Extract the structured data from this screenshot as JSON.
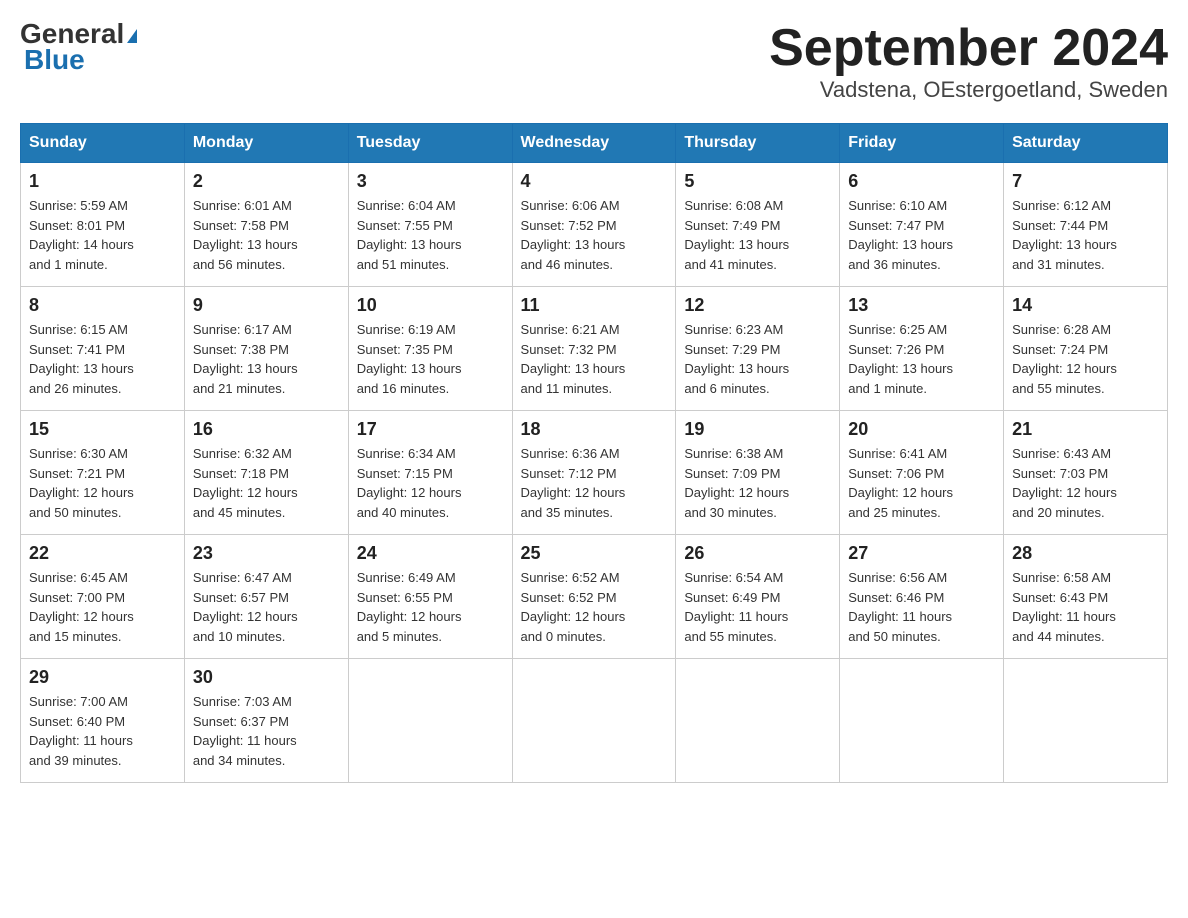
{
  "header": {
    "logo_general": "General",
    "logo_blue": "Blue",
    "month_title": "September 2024",
    "location": "Vadstena, OEstergoetland, Sweden"
  },
  "weekdays": [
    "Sunday",
    "Monday",
    "Tuesday",
    "Wednesday",
    "Thursday",
    "Friday",
    "Saturday"
  ],
  "weeks": [
    [
      {
        "day": "1",
        "sunrise": "5:59 AM",
        "sunset": "8:01 PM",
        "daylight": "14 hours and 1 minute."
      },
      {
        "day": "2",
        "sunrise": "6:01 AM",
        "sunset": "7:58 PM",
        "daylight": "13 hours and 56 minutes."
      },
      {
        "day": "3",
        "sunrise": "6:04 AM",
        "sunset": "7:55 PM",
        "daylight": "13 hours and 51 minutes."
      },
      {
        "day": "4",
        "sunrise": "6:06 AM",
        "sunset": "7:52 PM",
        "daylight": "13 hours and 46 minutes."
      },
      {
        "day": "5",
        "sunrise": "6:08 AM",
        "sunset": "7:49 PM",
        "daylight": "13 hours and 41 minutes."
      },
      {
        "day": "6",
        "sunrise": "6:10 AM",
        "sunset": "7:47 PM",
        "daylight": "13 hours and 36 minutes."
      },
      {
        "day": "7",
        "sunrise": "6:12 AM",
        "sunset": "7:44 PM",
        "daylight": "13 hours and 31 minutes."
      }
    ],
    [
      {
        "day": "8",
        "sunrise": "6:15 AM",
        "sunset": "7:41 PM",
        "daylight": "13 hours and 26 minutes."
      },
      {
        "day": "9",
        "sunrise": "6:17 AM",
        "sunset": "7:38 PM",
        "daylight": "13 hours and 21 minutes."
      },
      {
        "day": "10",
        "sunrise": "6:19 AM",
        "sunset": "7:35 PM",
        "daylight": "13 hours and 16 minutes."
      },
      {
        "day": "11",
        "sunrise": "6:21 AM",
        "sunset": "7:32 PM",
        "daylight": "13 hours and 11 minutes."
      },
      {
        "day": "12",
        "sunrise": "6:23 AM",
        "sunset": "7:29 PM",
        "daylight": "13 hours and 6 minutes."
      },
      {
        "day": "13",
        "sunrise": "6:25 AM",
        "sunset": "7:26 PM",
        "daylight": "13 hours and 1 minute."
      },
      {
        "day": "14",
        "sunrise": "6:28 AM",
        "sunset": "7:24 PM",
        "daylight": "12 hours and 55 minutes."
      }
    ],
    [
      {
        "day": "15",
        "sunrise": "6:30 AM",
        "sunset": "7:21 PM",
        "daylight": "12 hours and 50 minutes."
      },
      {
        "day": "16",
        "sunrise": "6:32 AM",
        "sunset": "7:18 PM",
        "daylight": "12 hours and 45 minutes."
      },
      {
        "day": "17",
        "sunrise": "6:34 AM",
        "sunset": "7:15 PM",
        "daylight": "12 hours and 40 minutes."
      },
      {
        "day": "18",
        "sunrise": "6:36 AM",
        "sunset": "7:12 PM",
        "daylight": "12 hours and 35 minutes."
      },
      {
        "day": "19",
        "sunrise": "6:38 AM",
        "sunset": "7:09 PM",
        "daylight": "12 hours and 30 minutes."
      },
      {
        "day": "20",
        "sunrise": "6:41 AM",
        "sunset": "7:06 PM",
        "daylight": "12 hours and 25 minutes."
      },
      {
        "day": "21",
        "sunrise": "6:43 AM",
        "sunset": "7:03 PM",
        "daylight": "12 hours and 20 minutes."
      }
    ],
    [
      {
        "day": "22",
        "sunrise": "6:45 AM",
        "sunset": "7:00 PM",
        "daylight": "12 hours and 15 minutes."
      },
      {
        "day": "23",
        "sunrise": "6:47 AM",
        "sunset": "6:57 PM",
        "daylight": "12 hours and 10 minutes."
      },
      {
        "day": "24",
        "sunrise": "6:49 AM",
        "sunset": "6:55 PM",
        "daylight": "12 hours and 5 minutes."
      },
      {
        "day": "25",
        "sunrise": "6:52 AM",
        "sunset": "6:52 PM",
        "daylight": "12 hours and 0 minutes."
      },
      {
        "day": "26",
        "sunrise": "6:54 AM",
        "sunset": "6:49 PM",
        "daylight": "11 hours and 55 minutes."
      },
      {
        "day": "27",
        "sunrise": "6:56 AM",
        "sunset": "6:46 PM",
        "daylight": "11 hours and 50 minutes."
      },
      {
        "day": "28",
        "sunrise": "6:58 AM",
        "sunset": "6:43 PM",
        "daylight": "11 hours and 44 minutes."
      }
    ],
    [
      {
        "day": "29",
        "sunrise": "7:00 AM",
        "sunset": "6:40 PM",
        "daylight": "11 hours and 39 minutes."
      },
      {
        "day": "30",
        "sunrise": "7:03 AM",
        "sunset": "6:37 PM",
        "daylight": "11 hours and 34 minutes."
      },
      null,
      null,
      null,
      null,
      null
    ]
  ],
  "labels": {
    "sunrise": "Sunrise:",
    "sunset": "Sunset:",
    "daylight": "Daylight:"
  }
}
